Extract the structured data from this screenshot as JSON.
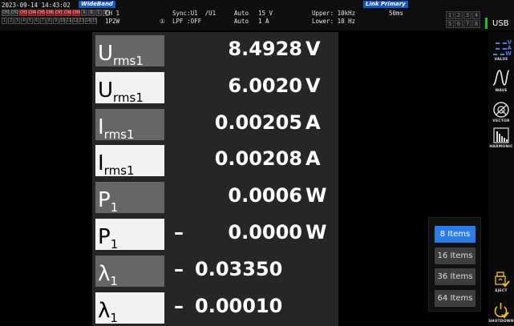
{
  "header": {
    "datetime": "2023-09-14 14:43:02",
    "bandwidth_badge": "WideBand",
    "ch_row1": [
      "CH1",
      "CH2",
      "CH3",
      "CH4",
      "CH5",
      "CH6",
      "CH7",
      "CH8",
      "CH9",
      "A",
      "B",
      "C",
      "D"
    ],
    "ch_row2": [
      "1",
      "2",
      "3",
      "4",
      "5",
      "6",
      "7",
      "8",
      "9",
      "10",
      "11",
      "12",
      "13",
      "14",
      "15"
    ],
    "channel": "CH 1",
    "wiring": "1P2W",
    "sync": "Sync:U1  /U1",
    "lpf_circle": "①",
    "lpf": "LPF :OFF",
    "voltage_range_mode": "Auto",
    "voltage_range": "15 V",
    "current_range_mode": "Auto",
    "current_range": "1 A",
    "link_badge": "Link Primary",
    "upper": "Upper: 10kHz",
    "lower": "Lower: 10 Hz",
    "interval": "50ms",
    "num_grid": [
      "1",
      "2",
      "3",
      "4",
      "5",
      "6",
      "7",
      "8"
    ],
    "usb_label": "USB"
  },
  "rows": [
    {
      "symbol": "U",
      "sub": "rms1",
      "sign": "",
      "value": "8.4928",
      "unit": "V",
      "style": "dark"
    },
    {
      "symbol": "U",
      "sub": "rms1",
      "sign": "",
      "value": "6.0020",
      "unit": "V",
      "style": "light"
    },
    {
      "symbol": "I",
      "sub": "rms1",
      "sign": "",
      "value": "0.00205",
      "unit": "A",
      "style": "dark"
    },
    {
      "symbol": "I",
      "sub": "rms1",
      "sign": "",
      "value": "0.00208",
      "unit": "A",
      "style": "light"
    },
    {
      "symbol": "P",
      "sub": "1",
      "sign": "",
      "value": "0.0006",
      "unit": "W",
      "style": "dark"
    },
    {
      "symbol": "P",
      "sub": "1",
      "sign": "–",
      "value": "0.0000",
      "unit": "W",
      "style": "light"
    },
    {
      "symbol": "λ",
      "sub": "1",
      "sign": "–",
      "value": "0.03350",
      "unit": "",
      "style": "dark"
    },
    {
      "symbol": "λ",
      "sub": "1",
      "sign": "–",
      "value": "0.00010",
      "unit": "",
      "style": "light"
    }
  ],
  "items_selector": {
    "options": [
      "8 Items",
      "16 Items",
      "36 Items",
      "64 Items"
    ],
    "selected": "8 Items"
  },
  "sidebar": {
    "value_icon_letters": [
      "V",
      "A",
      "W"
    ],
    "value_label": "VALUE",
    "wave_label": "WAVE",
    "vector_label": "VECTOR",
    "harmonic_label": "HARMONIC",
    "eject_label": "EJECT",
    "shutdown_label": "SHUTDOWN"
  },
  "colors": {
    "accent_blue": "#2b7de9",
    "badge_blue": "#1558c8",
    "usb_green": "#19c030",
    "sidebar_yellow": "#f2c318"
  }
}
